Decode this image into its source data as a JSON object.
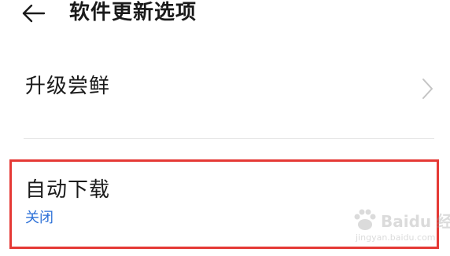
{
  "header": {
    "title": "软件更新选项",
    "back_icon": "arrow-left-icon"
  },
  "settings": {
    "upgrade": {
      "label": "升级尝鲜",
      "icon": "chevron-right-icon"
    },
    "auto_download": {
      "label": "自动下载",
      "value": "关闭",
      "value_color": "#2f72d8",
      "highlight_color": "#e53935"
    }
  },
  "watermark": {
    "brand": "Baidu 经验",
    "url": "jingyan.baidu.com"
  }
}
